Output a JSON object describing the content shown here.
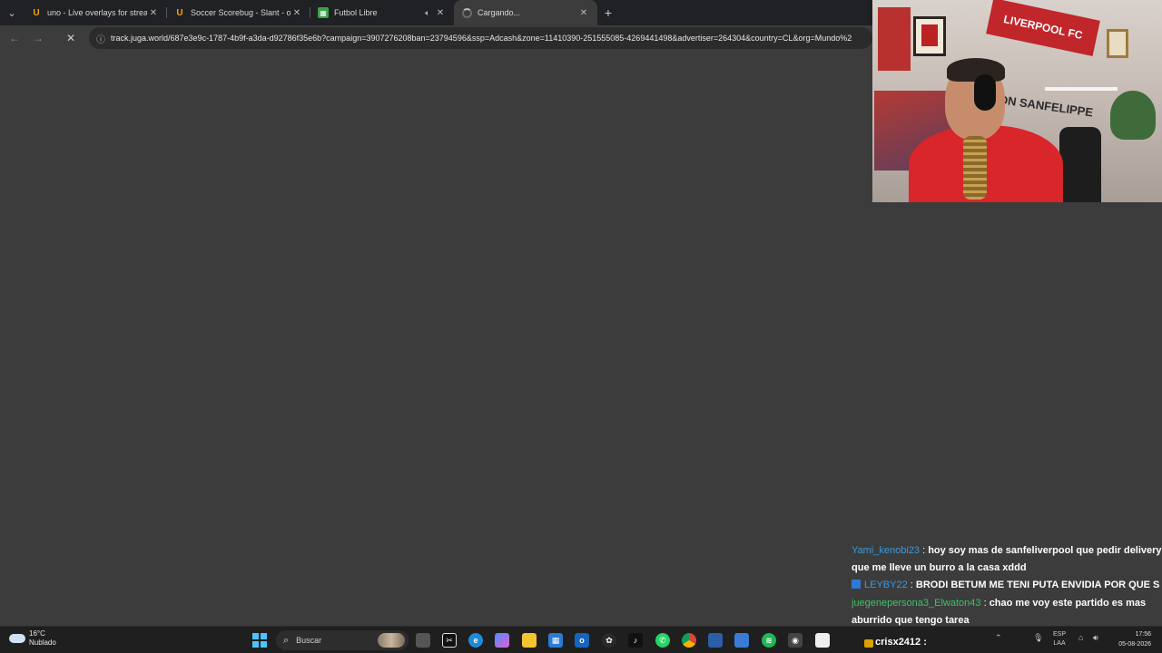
{
  "browser": {
    "tabs": [
      {
        "title": "uno - Live overlays for streamin",
        "favicon": "uno-logo-icon",
        "favicon_color": "#f2a900",
        "active": false
      },
      {
        "title": "Soccer Scorebug - Slant - overl",
        "favicon": "uno-logo-icon",
        "favicon_color": "#f2a900",
        "active": false
      },
      {
        "title": "Futbol Libre",
        "favicon": "soccer-field-icon",
        "favicon_color": "#3aa34a",
        "active": false,
        "audio": true
      },
      {
        "title": "Cargando...",
        "favicon": "loading-spinner-icon",
        "active": true
      }
    ],
    "url": "track.juga.world/687e3e9c-1787-4b9f-a3da-d92786f35e6b?campaign=3907276208ban=23794596&ssp=Adcash&zone=11410390-251555085-4269441498&advertiser=264304&country=CL&org=Mundo%2"
  },
  "webcam": {
    "banner_text": "LIVERPOOL FC",
    "wall_text": "AÑON SANFELIPPE"
  },
  "chat": {
    "messages": [
      {
        "user": "Yami_kenobi23",
        "text": "hoy soy mas de sanfeliverpool que pedir delivery que me lleve un burro a la casa xddd",
        "user_color": "#3a9be0"
      },
      {
        "user": "LEYBY22",
        "text": "BRODI BETUM ME TENI PUTA ENVIDIA POR QUE S",
        "user_color": "#3a9be0",
        "badge": true
      },
      {
        "user": "juegenepersona3_Elwaton43",
        "text": "chao me voy este partido es mas aburrido que tengo tarea",
        "user_color": "#3ec266"
      }
    ]
  },
  "taskbar": {
    "weather_temp": "16°C",
    "weather_desc": "Nublado",
    "search_label": "Buscar",
    "alert_user": "crisx2412 :",
    "lang_1": "ESP",
    "lang_2": "LAA",
    "time": "17:56",
    "date": "05-08-2026"
  }
}
